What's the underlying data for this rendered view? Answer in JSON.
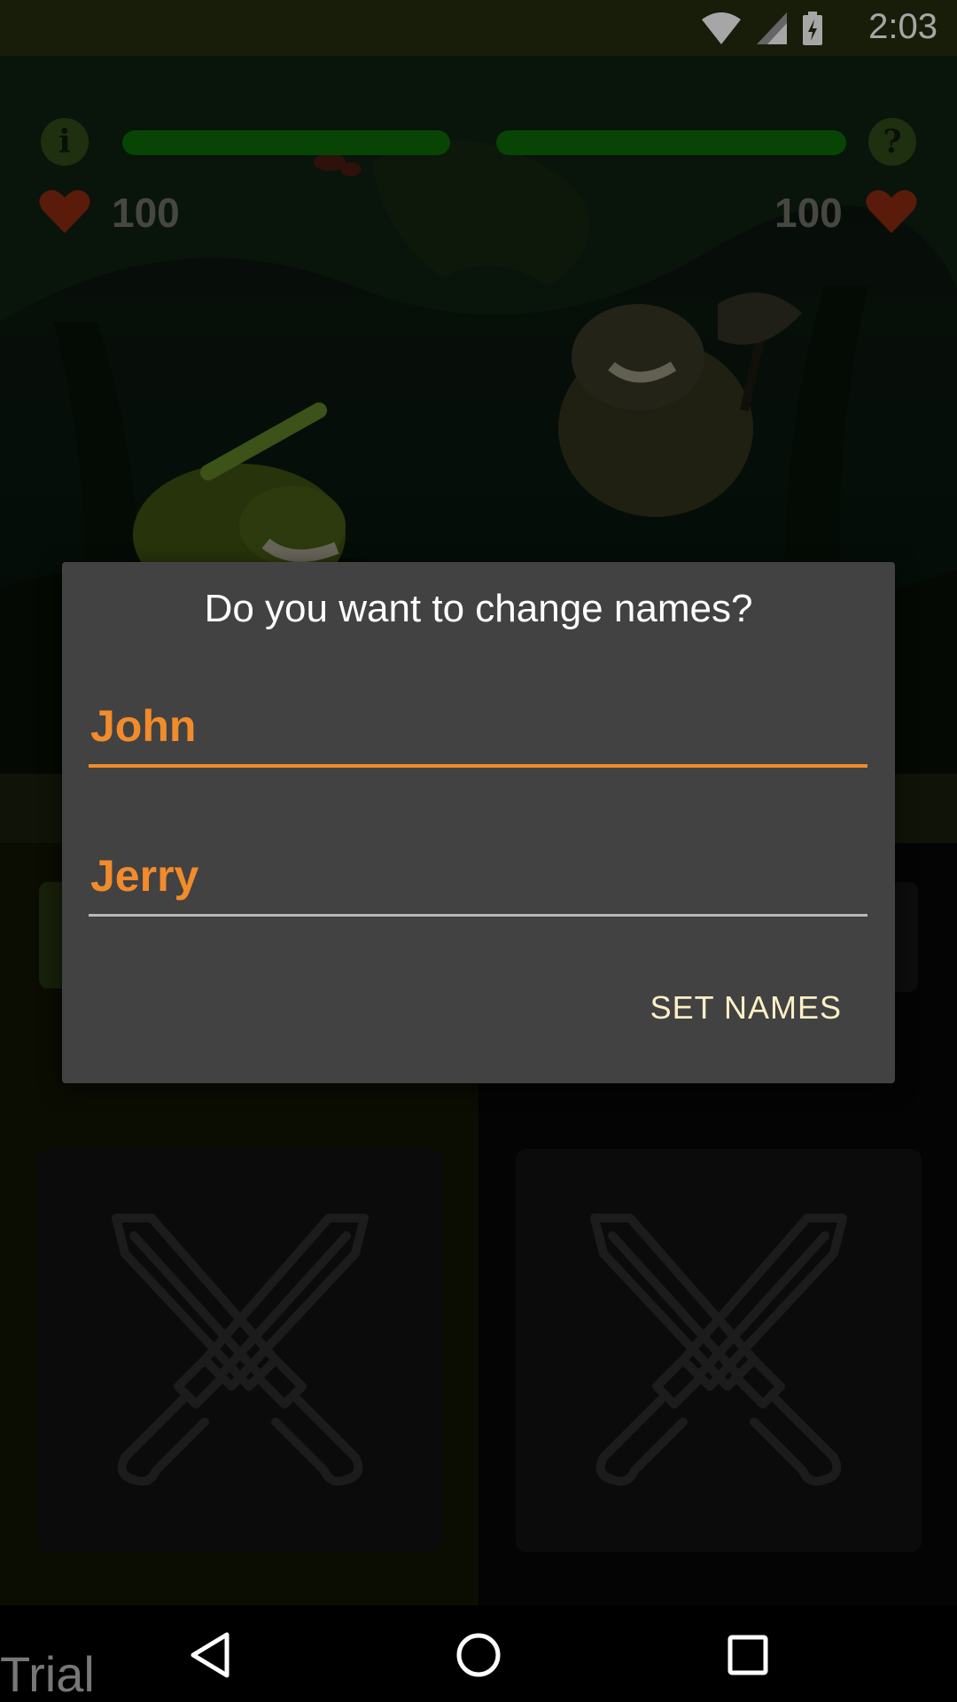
{
  "status_bar": {
    "time": "2:03",
    "icons": [
      "wifi-icon",
      "signal-icon",
      "battery-charging-icon"
    ]
  },
  "game": {
    "player_left": {
      "hp": "100",
      "hp_fraction": 1.0
    },
    "player_right": {
      "hp": "100",
      "hp_fraction": 1.0
    },
    "info_icon": "i",
    "help_icon": "?"
  },
  "dialog": {
    "title": "Do you want to change names?",
    "name1": "John",
    "name2": "Jerry",
    "button": "SET NAMES"
  },
  "overlay_label": "Trial",
  "colors": {
    "accent": "#f28b2b",
    "dialog_bg": "#424242",
    "hp_green": "#0d6a08",
    "heart_red": "#8a2a12"
  }
}
